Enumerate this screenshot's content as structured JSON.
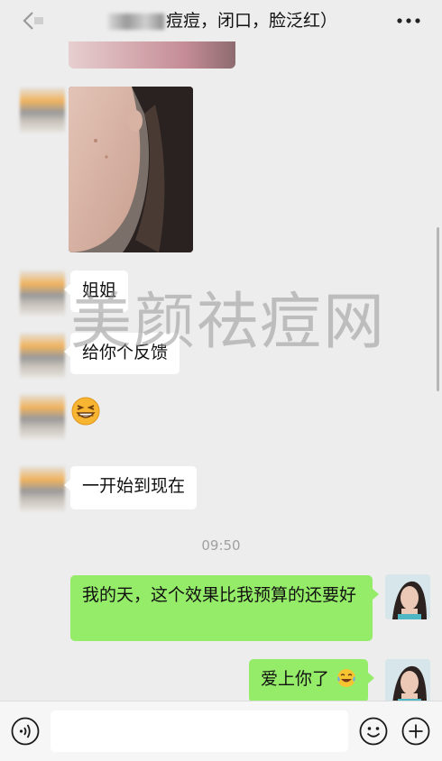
{
  "header": {
    "title": "痘痘，闭口，脸泛红）",
    "back_icon": "chevron-left-icon",
    "more_icon": "more-dots-icon"
  },
  "messages": [
    {
      "side": "left",
      "kind": "image",
      "note_icon": "photo"
    },
    {
      "side": "left",
      "kind": "image",
      "note_icon": "photo"
    },
    {
      "side": "left",
      "kind": "text",
      "text": "姐姐"
    },
    {
      "side": "left",
      "kind": "text",
      "text": "给你个反馈"
    },
    {
      "side": "left",
      "kind": "emoji",
      "emoji": "grin-squint-emoji"
    },
    {
      "side": "left",
      "kind": "text",
      "text": "一开始到现在"
    },
    {
      "side": "right",
      "kind": "text",
      "text": "我的天，这个效果比我预算的还要好"
    },
    {
      "side": "right",
      "kind": "text",
      "text": "爱上你了",
      "emoji": "tears-of-joy-emoji"
    }
  ],
  "timestamp": "09:50",
  "watermark": "美颜祛痘网",
  "bottom_bar": {
    "voice_icon": "voice-icon",
    "input_value": "",
    "sticker_icon": "smiley-icon",
    "plus_icon": "plus-icon"
  },
  "colors": {
    "background": "#ededed",
    "bubble_left": "#ffffff",
    "bubble_right": "#95ec69",
    "timestamp": "#a0a0a0"
  }
}
